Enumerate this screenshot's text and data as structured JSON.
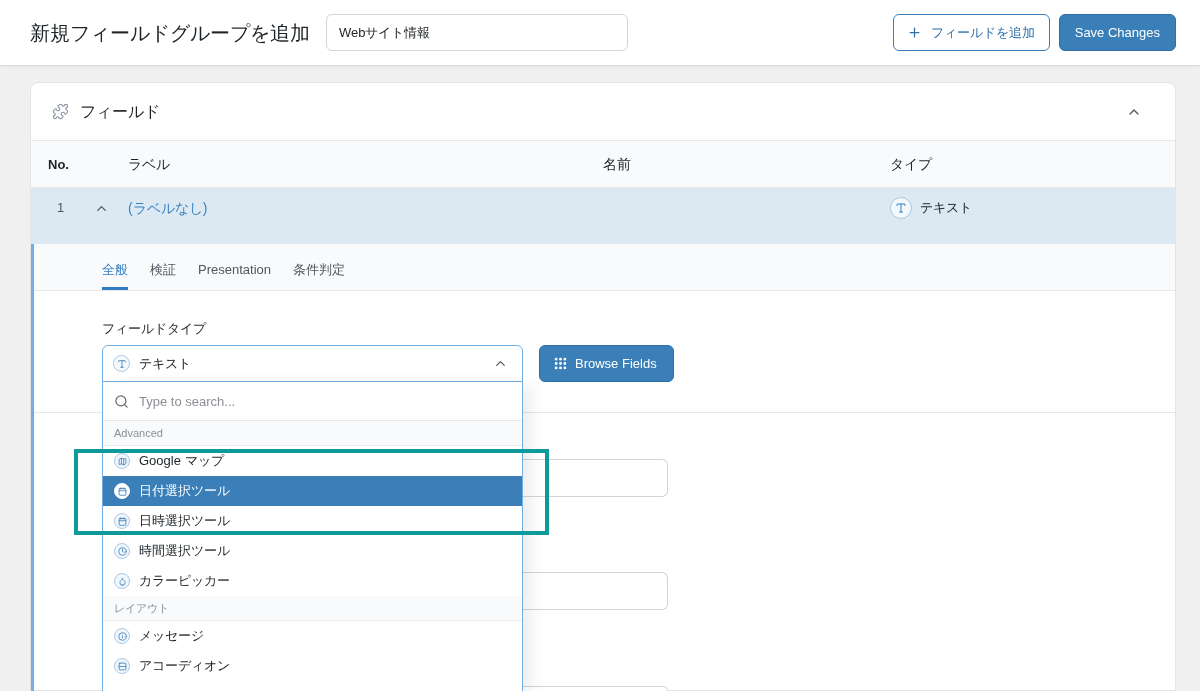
{
  "header": {
    "title": "新規フィールドグループを追加",
    "title_field": {
      "value": "Webサイト情報"
    },
    "buttons": [
      {
        "kind": "add",
        "label": "フィールドを追加"
      },
      {
        "kind": "save",
        "label": "Save Changes"
      }
    ]
  },
  "fields_panel": {
    "title": "フィールド",
    "expanded": true,
    "columns": [
      "No.",
      "ラベル",
      "名前",
      "タイプ"
    ],
    "rows": [
      {
        "no": "1",
        "label": "(ラベルなし)",
        "type": "テキスト",
        "expanded": true
      }
    ]
  },
  "field_settings": {
    "tabs": [
      {
        "label": "全般",
        "selected": true
      },
      {
        "label": "検証",
        "selected": false
      },
      {
        "label": "Presentation",
        "selected": false
      },
      {
        "label": "条件判定",
        "selected": false
      }
    ],
    "field_type": {
      "label": "フィールドタイプ",
      "value": "テキスト",
      "expanded": true
    },
    "browse_button": {
      "label": "Browse Fields"
    },
    "dropdown": {
      "search_placeholder": "Type to search...",
      "groups": [
        {
          "label": "Advanced",
          "items": [
            {
              "kind": "map",
              "label": "Google マップ",
              "selected": false
            },
            {
              "kind": "date",
              "label": "日付選択ツール",
              "selected": true
            },
            {
              "kind": "date",
              "label": "日時選択ツール",
              "selected": false
            },
            {
              "kind": "time",
              "label": "時間選択ツール",
              "selected": false
            },
            {
              "kind": "color",
              "label": "カラーピッカー",
              "selected": false
            }
          ]
        },
        {
          "label": "レイアウト",
          "items": [
            {
              "kind": "message",
              "label": "メッセージ",
              "selected": false
            },
            {
              "kind": "accordion",
              "label": "アコーディオン",
              "selected": false
            }
          ]
        }
      ]
    }
  }
}
